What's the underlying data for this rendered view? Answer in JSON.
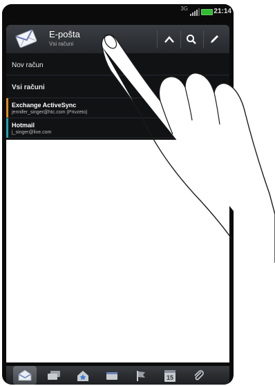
{
  "status_bar": {
    "network": "3G",
    "time": "21:14"
  },
  "header": {
    "title": "E-pošta",
    "subtitle": "Vsi računi"
  },
  "dropdown": {
    "new_account": "Nov račun",
    "all_accounts": "Vsi računi",
    "accounts": [
      {
        "name": "Exchange ActiveSync",
        "email": "jennifer_singer@htc.com (Privzeto)",
        "color": "#e08a1e"
      },
      {
        "name": "Hotmail",
        "email": "j_singer@live.com",
        "color": "#1aa6b7"
      }
    ]
  },
  "toolbar_icons": [
    "collapse-icon",
    "search-icon",
    "compose-icon"
  ],
  "bottom_tabs": [
    {
      "icon": "inbox-icon",
      "active": true
    },
    {
      "icon": "conversations-icon"
    },
    {
      "icon": "vip-group-icon"
    },
    {
      "icon": "unread-icon"
    },
    {
      "icon": "flagged-icon"
    },
    {
      "icon": "invitations-icon",
      "label": "15"
    },
    {
      "icon": "attachments-icon"
    }
  ],
  "theme": {
    "accent": "#3b3f44",
    "background": "#ffffff"
  }
}
